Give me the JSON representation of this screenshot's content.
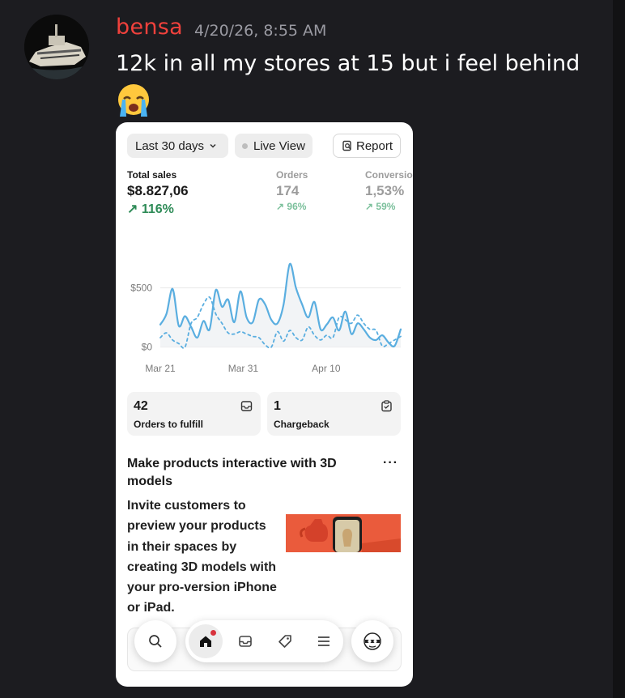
{
  "message": {
    "author": "bensa",
    "timestamp": "4/20/26, 8:55 AM",
    "text": "12k in all my stores at 15 but i feel behind",
    "emoji": "loudly-crying-face"
  },
  "screenshot": {
    "filters": {
      "period": "Last 30 days",
      "live_view": "Live View",
      "report": "Report"
    },
    "metrics": {
      "total_sales": {
        "label": "Total sales",
        "value": "$8.827,06",
        "change": "116%"
      },
      "orders": {
        "label": "Orders",
        "value": "174",
        "change": "96%"
      },
      "conversion": {
        "label": "Conversio",
        "value": "1,53%",
        "change": "59%"
      }
    },
    "cards": {
      "fulfill": {
        "count": "42",
        "label": "Orders to fulfill"
      },
      "chargeback": {
        "count": "1",
        "label": "Chargeback"
      }
    },
    "promo": {
      "title": "Make products interactive with 3D models",
      "menu": "···",
      "body": "Invite customers to preview your products in their spaces by creating 3D models with your pro-version iPhone or iPad."
    },
    "nav": [
      "search-icon",
      "home-icon",
      "inbox-icon",
      "tag-icon",
      "menu-icon",
      "app-avatar-icon"
    ]
  },
  "chart_data": {
    "type": "line",
    "y_ticks": [
      "$500",
      "$0"
    ],
    "x_ticks": [
      "Mar 21",
      "Mar 31",
      "Apr 10"
    ],
    "ylim": [
      -50,
      700
    ],
    "grid": true,
    "series": [
      {
        "style": "solid",
        "color": "#5aaee0",
        "values": [
          190,
          280,
          490,
          180,
          260,
          170,
          80,
          220,
          150,
          480,
          340,
          400,
          210,
          470,
          250,
          210,
          400,
          360,
          230,
          200,
          360,
          700,
          500,
          360,
          250,
          380,
          150,
          190,
          250,
          140,
          300,
          110,
          200,
          150,
          80,
          60,
          100,
          40,
          10,
          150
        ]
      },
      {
        "style": "dashed",
        "color": "#5aaee0",
        "values": [
          80,
          120,
          60,
          30,
          0,
          200,
          250,
          360,
          420,
          280,
          200,
          120,
          110,
          130,
          110,
          90,
          80,
          20,
          0,
          130,
          50,
          140,
          80,
          60,
          170,
          100,
          60,
          100,
          80,
          250,
          230,
          200,
          270,
          200,
          150,
          140,
          10,
          30,
          60,
          90
        ]
      }
    ]
  }
}
